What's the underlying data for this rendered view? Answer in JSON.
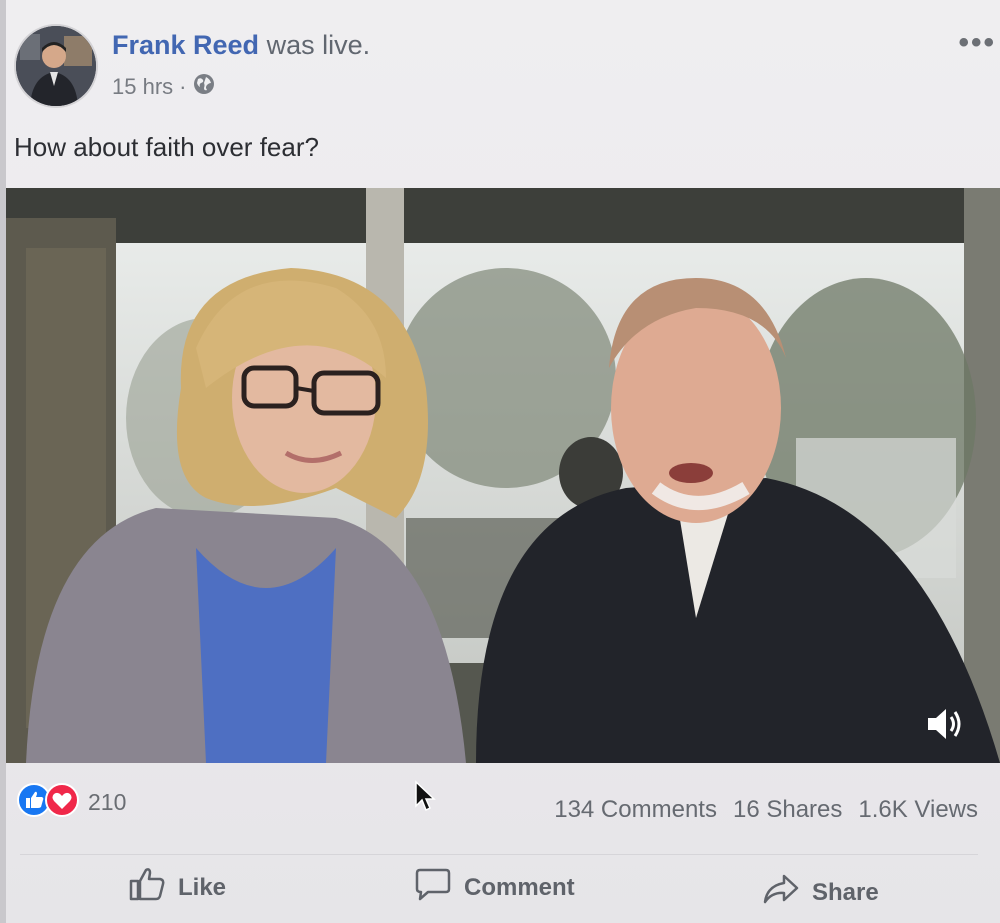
{
  "post": {
    "author_name": "Frank Reed",
    "status_text": "was live.",
    "timestamp": "15 hrs",
    "separator": "·",
    "privacy_icon": "globe-icon",
    "caption": "How about faith over fear?",
    "more_icon": "more-options-icon"
  },
  "video": {
    "sound_icon": "sound-on-icon"
  },
  "engagement": {
    "reaction_icons": [
      "like-reaction-icon",
      "love-reaction-icon"
    ],
    "reaction_count": "210",
    "comments": "134 Comments",
    "shares": "16 Shares",
    "views": "1.6K Views"
  },
  "actions": {
    "like_label": "Like",
    "comment_label": "Comment",
    "share_label": "Share"
  },
  "colors": {
    "brand_blue": "#4267b2",
    "like_blue": "#1877f2",
    "love_red": "#f0284a"
  }
}
